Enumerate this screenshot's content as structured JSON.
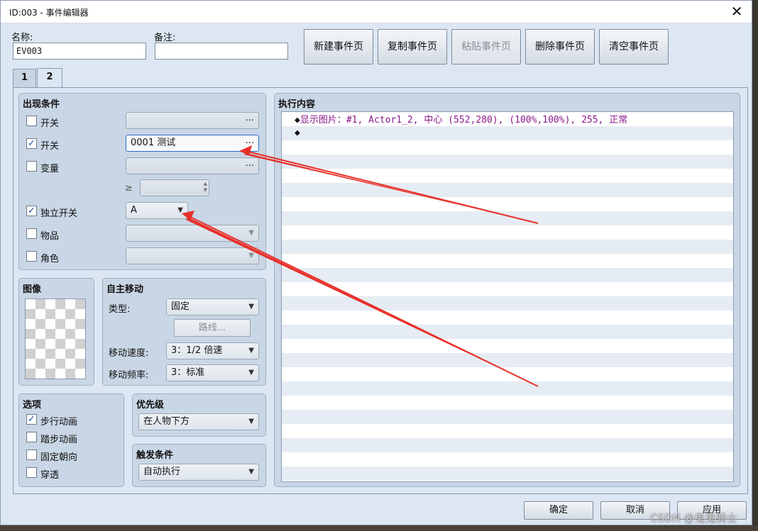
{
  "window": {
    "title": "ID:003 - 事件编辑器",
    "close_glyph": "✕"
  },
  "name_field": {
    "label": "名称:",
    "value": "EV003"
  },
  "note_field": {
    "label": "备注:",
    "value": ""
  },
  "toolbar": {
    "new_page": "新建事件页",
    "copy_page": "复制事件页",
    "paste_page": "粘贴事件页",
    "delete_page": "删除事件页",
    "clear_page": "清空事件页"
  },
  "tabs": [
    {
      "label": "1"
    },
    {
      "label": "2"
    }
  ],
  "conditions": {
    "title": "出现条件",
    "switch1": {
      "label": "开关",
      "checked": false,
      "value": ""
    },
    "switch2": {
      "label": "开关",
      "checked": true,
      "value": "0001 测试"
    },
    "variable": {
      "label": "变量",
      "checked": false,
      "value": "",
      "operator": "≥",
      "compare_value": ""
    },
    "self_switch": {
      "label": "独立开关",
      "checked": true,
      "value": "A"
    },
    "item": {
      "label": "物品",
      "checked": false,
      "value": ""
    },
    "actor": {
      "label": "角色",
      "checked": false,
      "value": ""
    },
    "dots": "..."
  },
  "image": {
    "title": "图像"
  },
  "autonomous": {
    "title": "自主移动",
    "type_label": "类型:",
    "type_value": "固定",
    "route_button": "路线...",
    "speed_label": "移动速度:",
    "speed_value": "3：1/2 倍速",
    "freq_label": "移动频率:",
    "freq_value": "3：标准"
  },
  "options": {
    "title": "选项",
    "items": [
      {
        "label": "步行动画",
        "checked": true
      },
      {
        "label": "踏步动画",
        "checked": false
      },
      {
        "label": "固定朝向",
        "checked": false
      },
      {
        "label": "穿透",
        "checked": false
      }
    ]
  },
  "priority": {
    "title": "优先级",
    "value": "在人物下方"
  },
  "trigger": {
    "title": "触发条件",
    "value": "自动执行"
  },
  "contents": {
    "title": "执行内容",
    "commands": [
      {
        "bullet": "◆",
        "text": "显示图片：#1, Actor1_2, 中心 (552,280), (100%,100%), 255, 正常"
      },
      {
        "bullet": "◆",
        "text": ""
      }
    ]
  },
  "footer": {
    "ok": "确定",
    "cancel": "取消",
    "apply": "应用"
  },
  "watermark": "CSDN @鬼鬼骑士",
  "colors": {
    "annotation_arrow": "#e8302a",
    "command_text": "#8a1a8a",
    "focus_border": "#2b6cd1"
  },
  "check_glyph": "✓",
  "dropdown_glyph": "▼",
  "spin_up_glyph": "▲",
  "spin_down_glyph": "▼"
}
